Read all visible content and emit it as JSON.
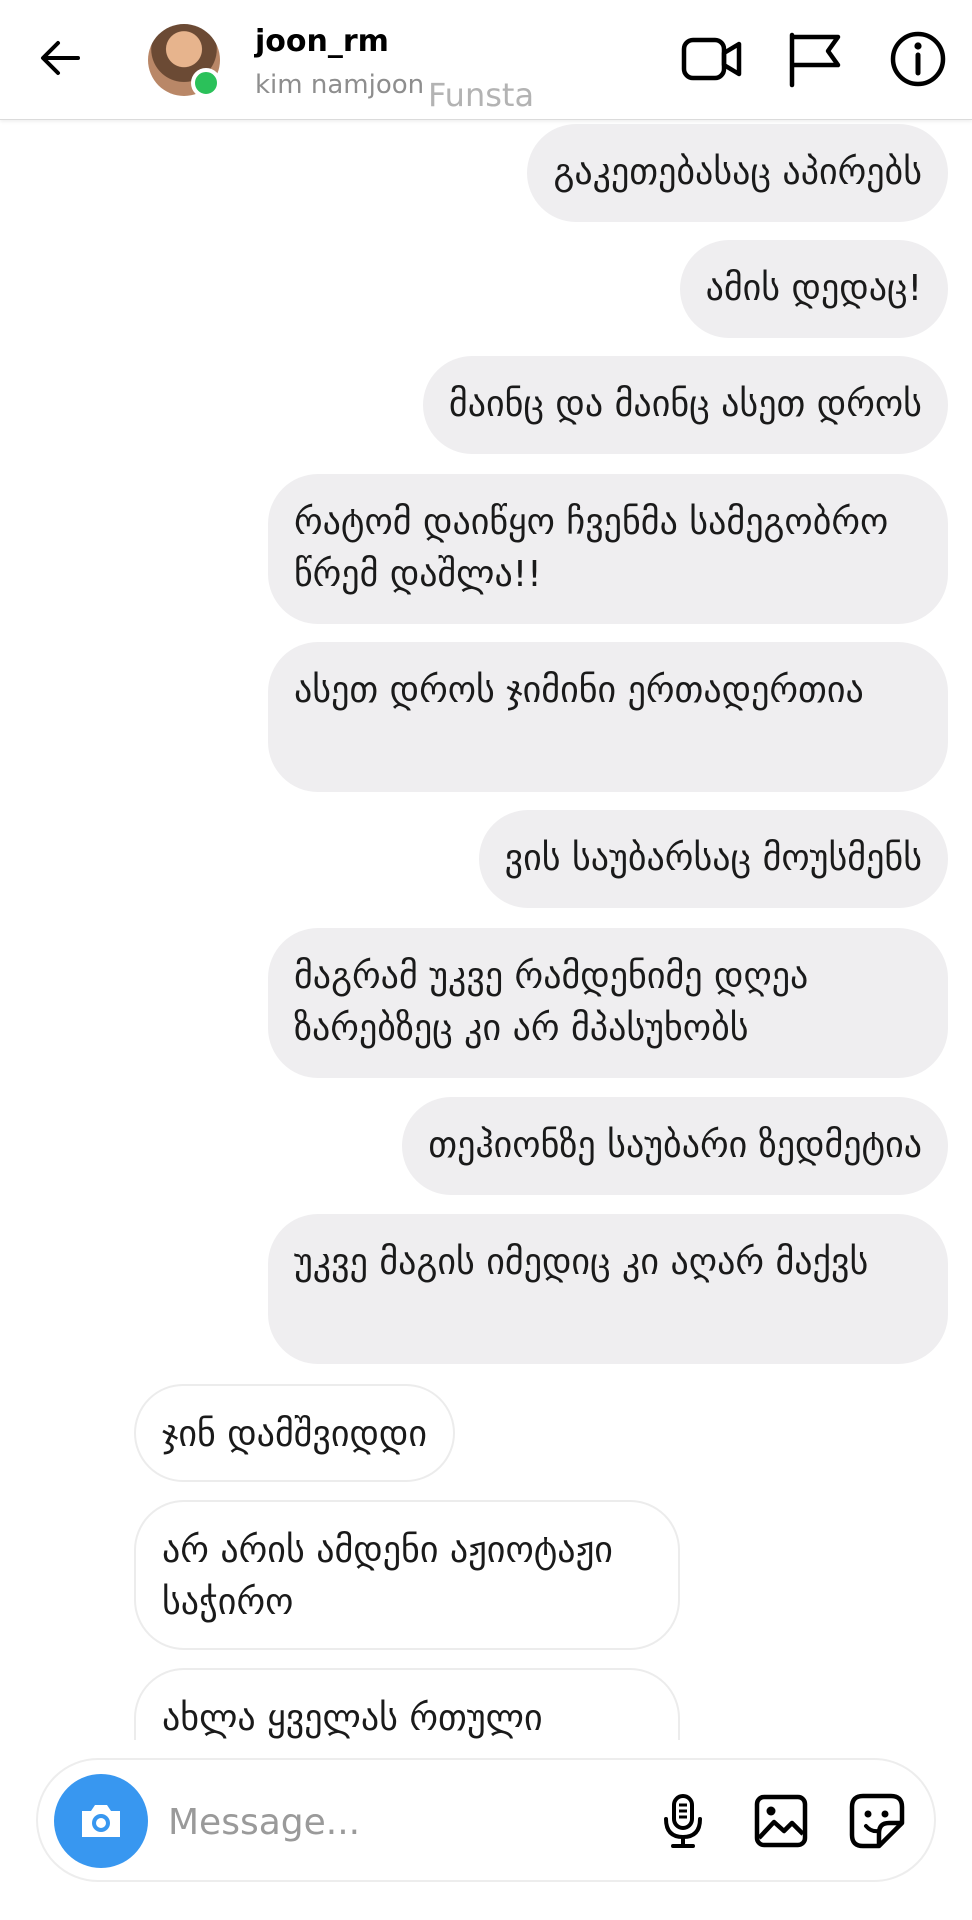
{
  "header": {
    "username": "joon_rm",
    "full_name": "kim namjoon",
    "watermark": "Funsta",
    "icons": [
      "back-arrow-icon",
      "video-call-icon",
      "flag-icon",
      "info-icon"
    ],
    "online_color": "#2bc15a"
  },
  "messages": [
    {
      "side": "sent",
      "text": "გაკეთებასაც აპირებს"
    },
    {
      "side": "sent",
      "text": "ამის დედაც!"
    },
    {
      "side": "sent",
      "text": "მაინც და მაინც ასეთ დროს"
    },
    {
      "side": "sent",
      "text": "რატომ დაიწყო ჩვენმა სამეგობრო წრემ დაშლა!!"
    },
    {
      "side": "sent",
      "text": "ასეთ დროს ჯიმინი ერთადერთია"
    },
    {
      "side": "sent",
      "text": "ვის საუბარსაც მოუსმენს"
    },
    {
      "side": "sent",
      "text": "მაგრამ უკვე რამდენიმე დღეა ზარებზეც კი არ მპასუხობს"
    },
    {
      "side": "sent",
      "text": "თეჰიონზე საუბარი ზედმეტია"
    },
    {
      "side": "sent",
      "text": "უკვე მაგის იმედიც კი აღარ მაქვს"
    },
    {
      "side": "received",
      "text": "ჯინ დამშვიდდი"
    },
    {
      "side": "received",
      "text": "არ არის ამდენი აჟიოტაჟი საჭირო"
    },
    {
      "side": "received",
      "text": "ახლა ყველას რთული"
    }
  ],
  "composer": {
    "placeholder": "Message...",
    "icons": [
      "camera-icon",
      "microphone-icon",
      "gallery-icon",
      "sticker-icon"
    ],
    "camera_color": "#3897f0"
  }
}
